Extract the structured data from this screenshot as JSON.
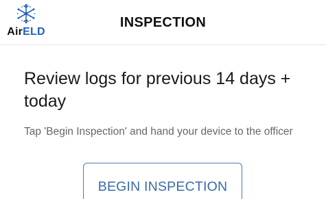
{
  "header": {
    "logo_text_air": "Air",
    "logo_text_eld": "ELD",
    "logo_icon": "snowflake-icon",
    "title": "INSPECTION"
  },
  "main": {
    "headline": "Review logs for previous 14 days + today",
    "instruction": "Tap 'Begin Inspection' and hand your device to the officer",
    "begin_button_label": "BEGIN INSPECTION"
  },
  "colors": {
    "brand_blue": "#1f5fbf",
    "button_border": "#4a7bb8",
    "button_text": "#3a6aa8",
    "header_text": "#111111",
    "body_text": "#1a1a1a",
    "secondary_text": "#666666"
  }
}
